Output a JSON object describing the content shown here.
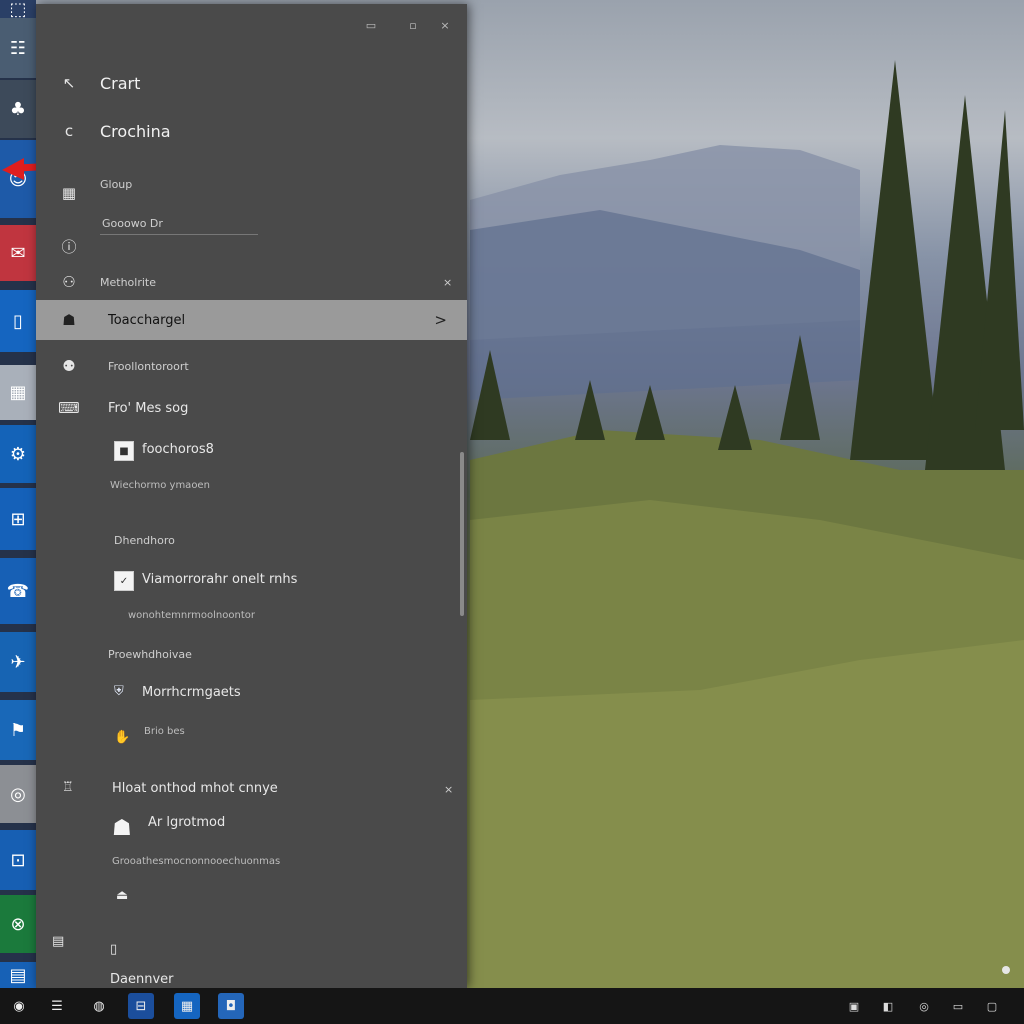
{
  "window": {
    "controls": {
      "minimize": "▭",
      "maximize": "▫",
      "close": "×"
    }
  },
  "header": {
    "back_label": "Crart",
    "back_icon": "arrow-left-icon",
    "home_label": "Crochina",
    "search_label": "Gloup",
    "search_placeholder": "Gooowo Dr"
  },
  "section": {
    "label": "Metholrite",
    "expand_icon": "×"
  },
  "nav": {
    "selected_label": "Toacchargel",
    "selected_chevron": ">",
    "item2_label": "Froollontoroort",
    "item3_label": "Fro' Mes sog"
  },
  "options": {
    "checkbox1_label": "foochoros8",
    "checkbox1_desc": "Wiechormo ymaoen",
    "group2_title": "Dhendhoro",
    "checkbox2_label": "Viamorrorahr onelt rnhs",
    "checkbox2_desc": "wonohtemnrmoolnoontor",
    "group3_title": "Proewhdhoivae",
    "item_shield_label": "Morrhcrmgaets",
    "item_thumb_label": "Brio bes",
    "group4_title": "Hloat onthod mhot cnnye",
    "group4_icon": "×",
    "item_lock_label": "Ar lgrotmod",
    "item_lock_desc": "Grooathesmocnonnooechuonmas",
    "footer_label": "Daennver"
  },
  "tiles": [
    {
      "glyph": "⬚",
      "color": "#2a3f66"
    },
    {
      "glyph": "☷",
      "color": "#4a5d72"
    },
    {
      "glyph": "♣",
      "color": "#3d4a5a"
    },
    {
      "glyph": "☺",
      "color": "#1e5aa8"
    },
    {
      "glyph": "✉",
      "color": "#c0353f"
    },
    {
      "glyph": "▯",
      "color": "#1565c0"
    },
    {
      "glyph": "▦",
      "color": "#a9b0ba"
    },
    {
      "glyph": "⚙",
      "color": "#1463b8"
    },
    {
      "glyph": "⊞",
      "color": "#1561b9"
    },
    {
      "glyph": "☎",
      "color": "#1760b5"
    },
    {
      "glyph": "✈",
      "color": "#1764b3"
    },
    {
      "glyph": "⚑",
      "color": "#1968b8"
    },
    {
      "glyph": "◎",
      "color": "#8c8f94"
    },
    {
      "glyph": "⊡",
      "color": "#175fb3"
    },
    {
      "glyph": "⊗",
      "color": "#1b7a3c"
    },
    {
      "glyph": "▤",
      "color": "#1761b6"
    }
  ],
  "taskbar": {
    "start": "◉",
    "apps": [
      "☰",
      "◍",
      "⊟",
      "▦",
      "◘"
    ],
    "tray": [
      "▣",
      "◧",
      "◎",
      "▭",
      "▢"
    ]
  },
  "colors": {
    "panel_bg": "#4a4a4a",
    "selected_bg": "#9a9a9a",
    "accent_red": "#e01e1e",
    "taskbar_bg": "#151515"
  }
}
